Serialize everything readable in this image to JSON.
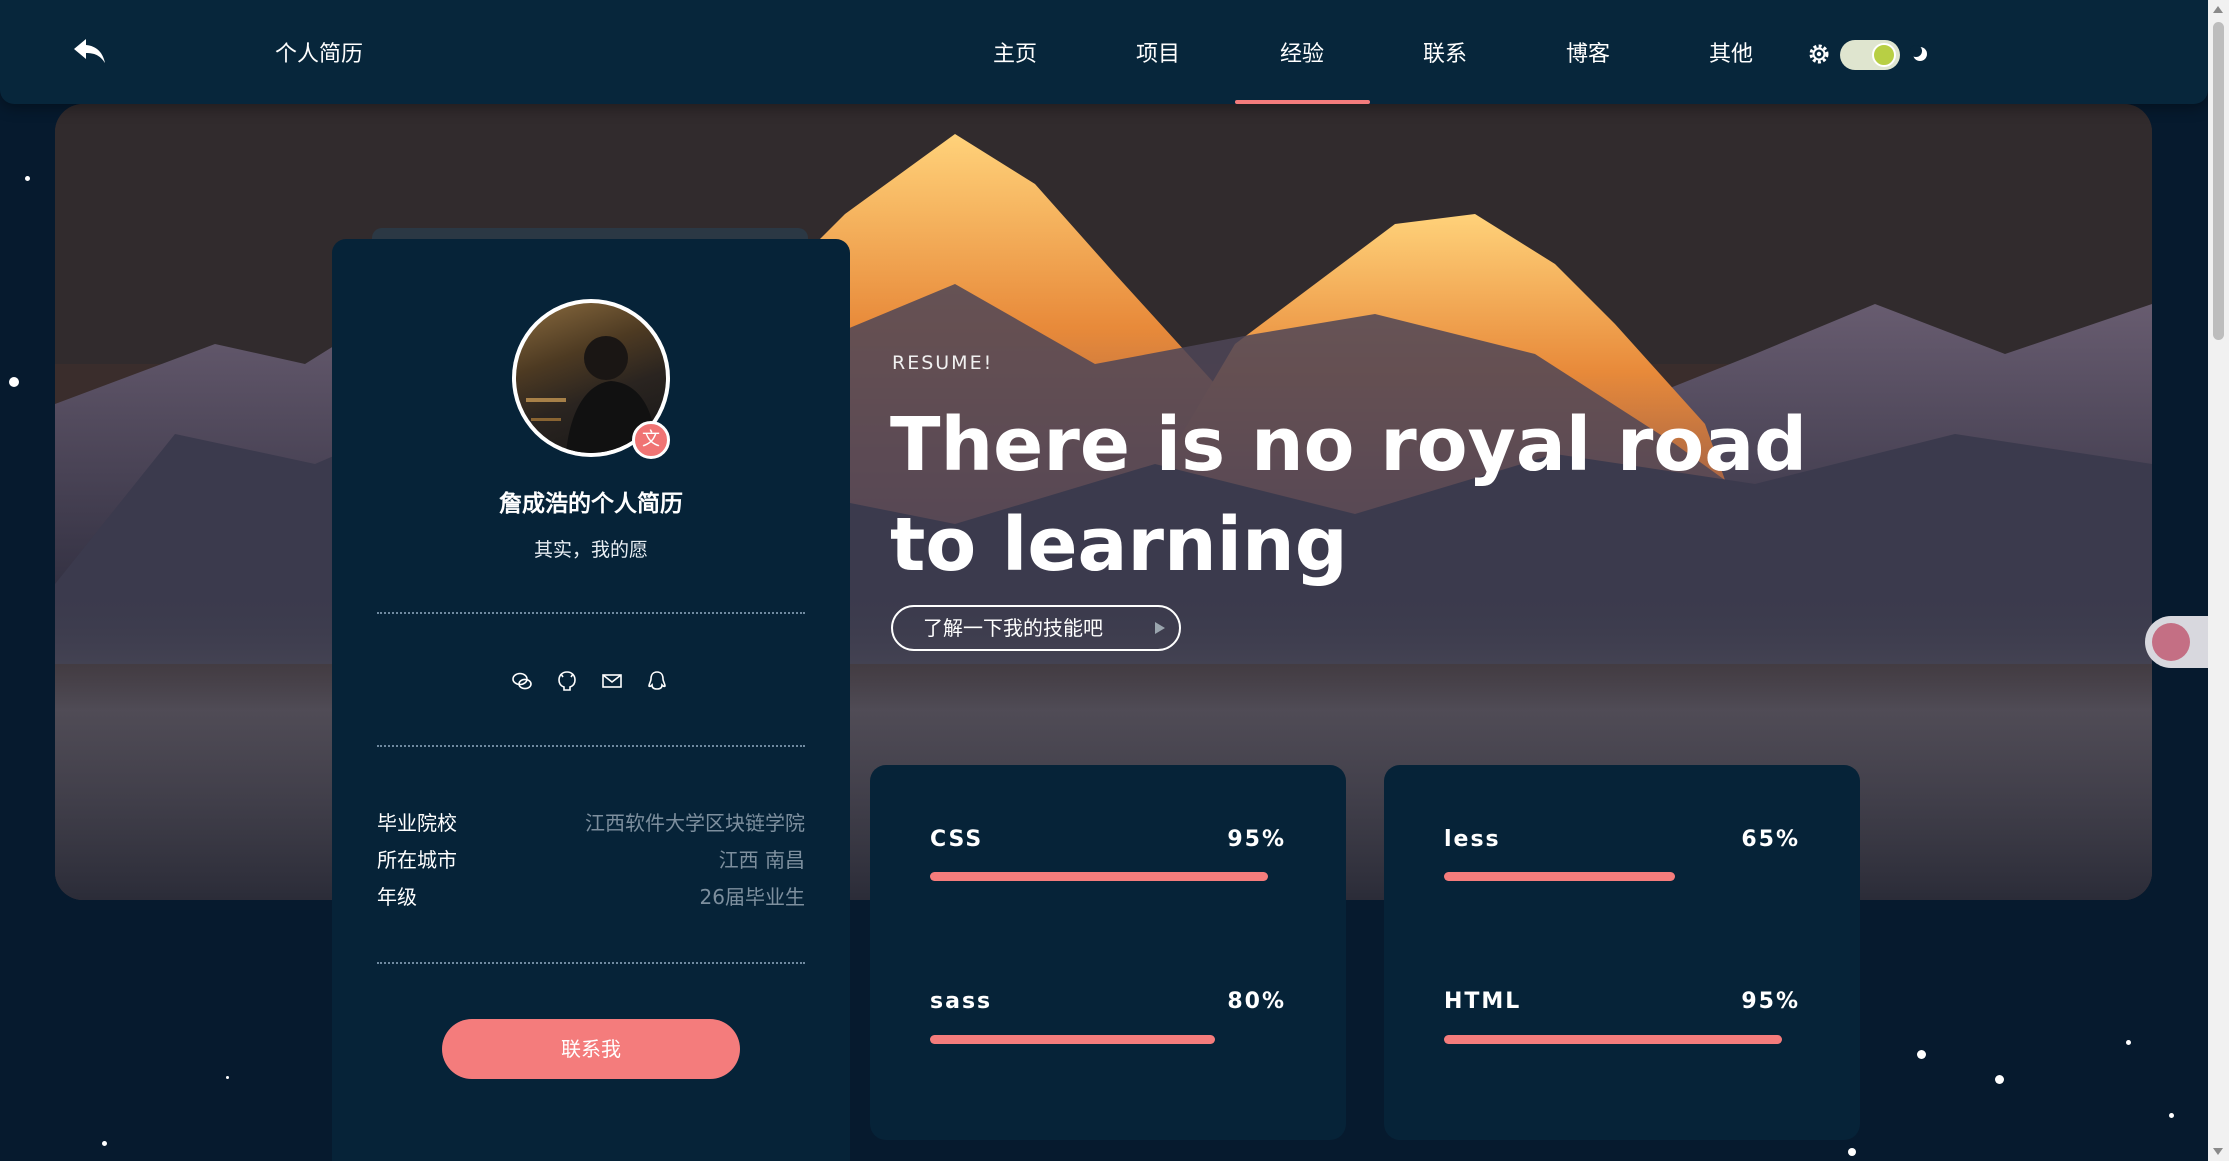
{
  "header": {
    "site_title": "个人简历",
    "nav": [
      {
        "label": "主页"
      },
      {
        "label": "项目"
      },
      {
        "label": "经验"
      },
      {
        "label": "联系"
      },
      {
        "label": "博客"
      },
      {
        "label": "其他"
      }
    ],
    "active_nav": "经验",
    "theme_toggle_on": true
  },
  "profile": {
    "avatar_badge": "文",
    "name": "詹成浩的个人简历",
    "motto": "其实，我的愿",
    "social_icons": [
      "wechat-icon",
      "github-icon",
      "mail-icon",
      "qq-icon"
    ],
    "info": [
      {
        "label": "毕业院校",
        "value": "江西软件大学区块链学院"
      },
      {
        "label": "所在城市",
        "value": "江西 南昌"
      },
      {
        "label": "年级",
        "value": "26届毕业生"
      }
    ],
    "contact_label": "联系我"
  },
  "hero": {
    "kicker": "RESUME!",
    "headline": "There is no royal road to learning",
    "cta_label": "了解一下我的技能吧"
  },
  "skills": [
    {
      "name": "CSS",
      "percent_label": "95%",
      "percent": 95
    },
    {
      "name": "less",
      "percent_label": "65%",
      "percent": 65
    },
    {
      "name": "sass",
      "percent_label": "80%",
      "percent": 80
    },
    {
      "name": "HTML",
      "percent_label": "95%",
      "percent": 95
    }
  ],
  "colors": {
    "accent": "#f47c7c",
    "card": "#062338",
    "background": "#061a2e",
    "header": "#07263b"
  }
}
